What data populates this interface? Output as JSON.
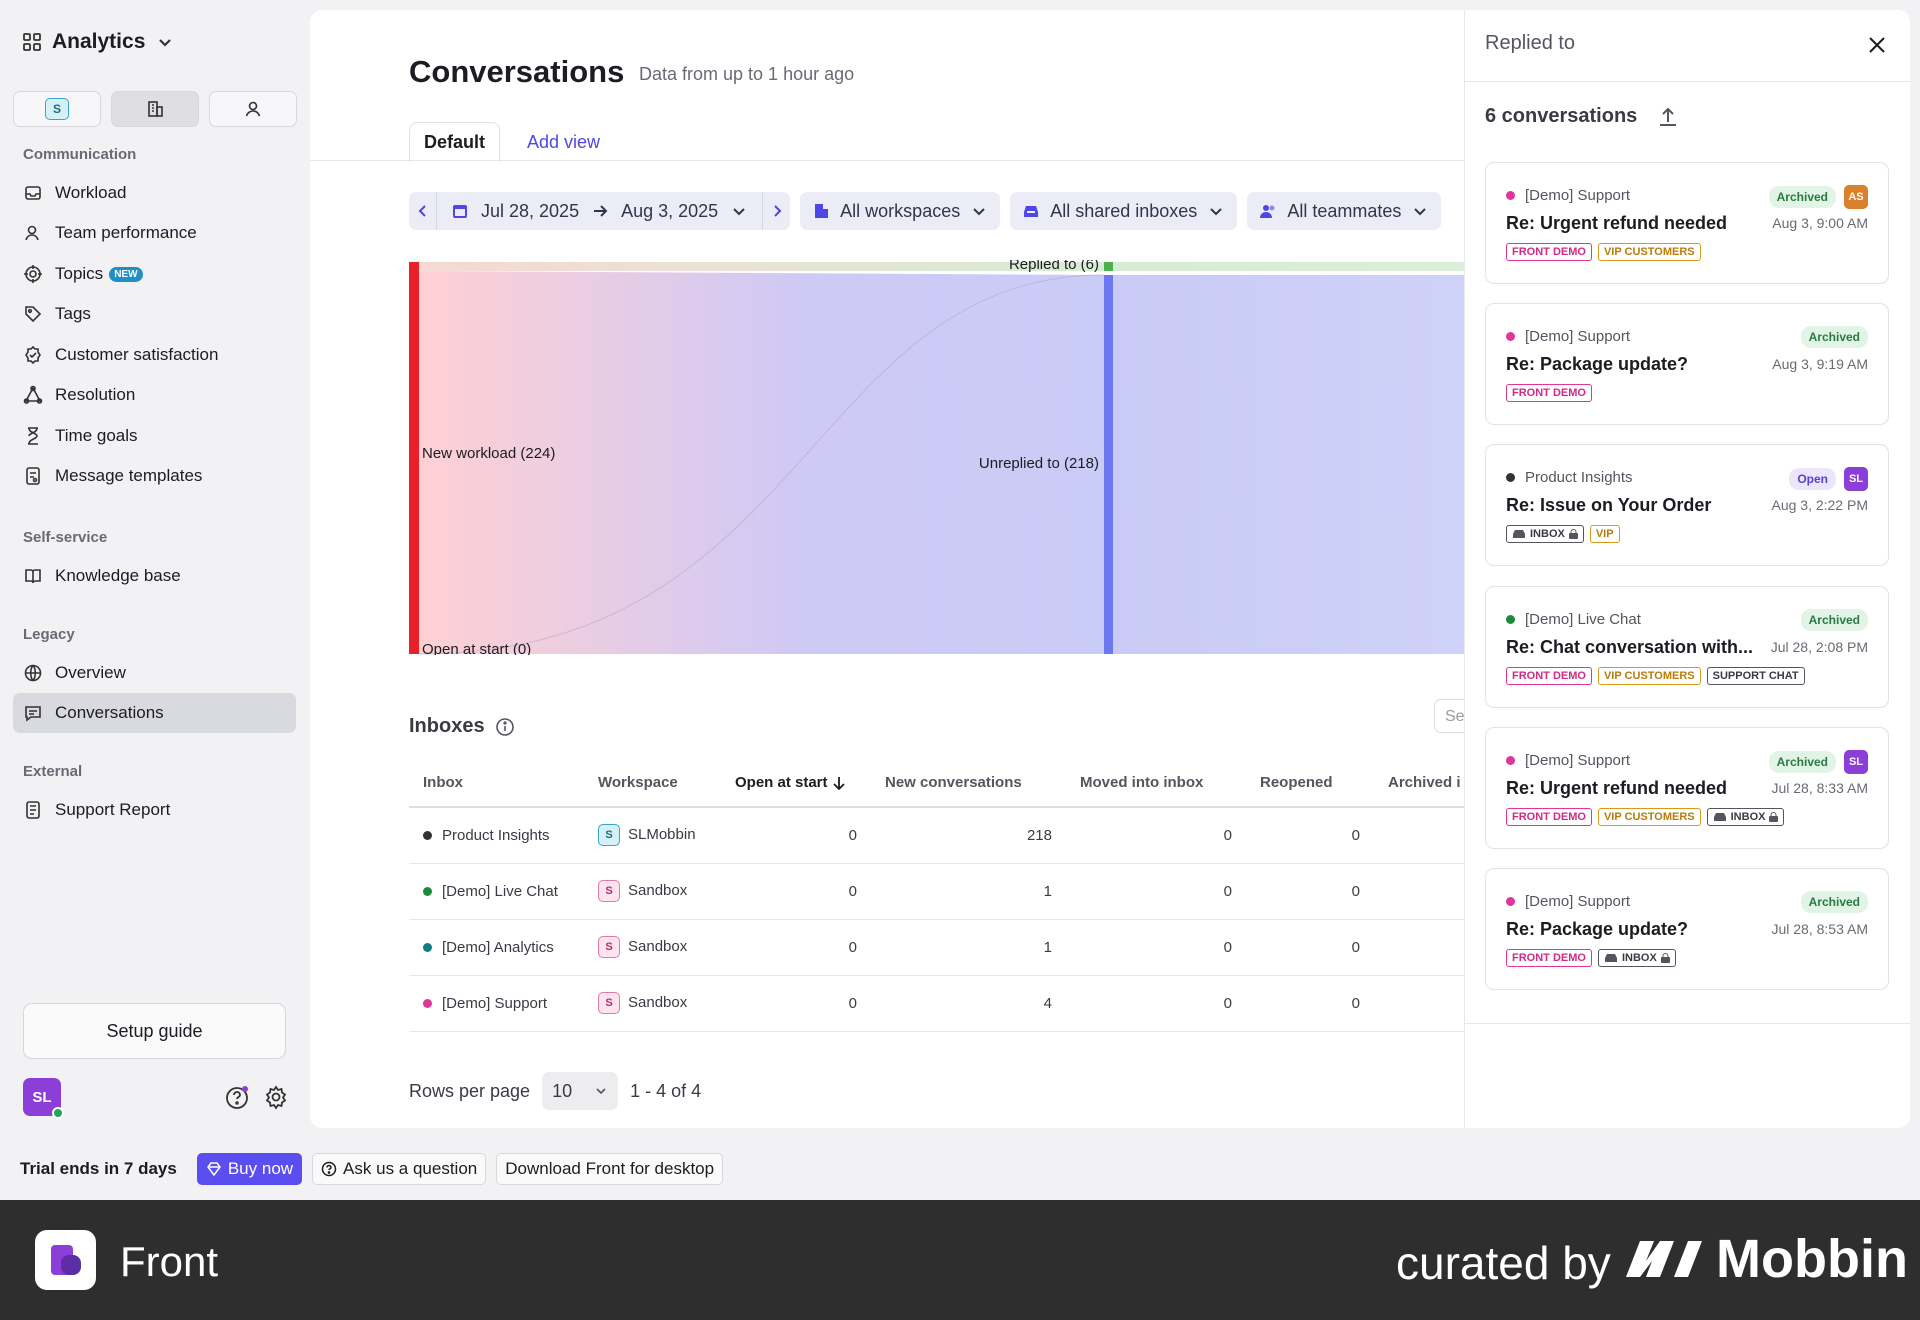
{
  "sidebar": {
    "app_title": "Analytics",
    "toggle_badge": "S",
    "sections": {
      "communication": "Communication",
      "self_service": "Self-service",
      "legacy": "Legacy",
      "external": "External"
    },
    "items": {
      "workload": "Workload",
      "team_performance": "Team performance",
      "topics": "Topics",
      "topics_badge": "NEW",
      "tags": "Tags",
      "customer_satisfaction": "Customer satisfaction",
      "resolution": "Resolution",
      "time_goals": "Time goals",
      "message_templates": "Message templates",
      "knowledge_base": "Knowledge base",
      "overview": "Overview",
      "conversations": "Conversations",
      "support_report": "Support Report"
    },
    "setup_guide": "Setup guide",
    "avatar_initials": "SL"
  },
  "header": {
    "title": "Conversations",
    "subtitle": "Data from up to 1 hour ago",
    "tabs": {
      "default": "Default",
      "add_view": "Add view"
    }
  },
  "filters": {
    "start_date": "Jul 28, 2025",
    "end_date": "Aug 3, 2025",
    "workspaces": "All workspaces",
    "inboxes": "All shared inboxes",
    "teammates": "All teammates"
  },
  "sankey": {
    "nodes": {
      "new_workload": "New workload (224)",
      "open_at_start": "Open at start (0)",
      "replied_to": "Replied to (6)",
      "unreplied_to": "Unreplied to (218)"
    },
    "colors": {
      "source": "#e8202a",
      "replied": "#4caf50",
      "unreplied": "#6c78f0"
    }
  },
  "inboxes": {
    "title": "Inboxes",
    "search_placeholder": "Se",
    "columns": [
      "Inbox",
      "Workspace",
      "Open at start",
      "New conversations",
      "Moved into inbox",
      "Reopened",
      "Archived i"
    ],
    "rows": [
      {
        "inbox": "Product Insights",
        "dot": "#333333",
        "ws_badge": "S",
        "ws_color": "cyan",
        "workspace": "SLMobbin",
        "open": "0",
        "new": "218",
        "moved": "0",
        "reopened": "0"
      },
      {
        "inbox": "[Demo] Live Chat",
        "dot": "#1e8a3c",
        "ws_badge": "S",
        "ws_color": "pink",
        "workspace": "Sandbox",
        "open": "0",
        "new": "1",
        "moved": "0",
        "reopened": "0"
      },
      {
        "inbox": "[Demo] Analytics",
        "dot": "#0e7c86",
        "ws_badge": "S",
        "ws_color": "pink",
        "workspace": "Sandbox",
        "open": "0",
        "new": "1",
        "moved": "0",
        "reopened": "0"
      },
      {
        "inbox": "[Demo] Support",
        "dot": "#e0359a",
        "ws_badge": "S",
        "ws_color": "pink",
        "workspace": "Sandbox",
        "open": "0",
        "new": "4",
        "moved": "0",
        "reopened": "0"
      }
    ]
  },
  "pagination": {
    "rows_per_page_label": "Rows per page",
    "rows_per_page": "10",
    "range": "1 - 4 of 4"
  },
  "panel": {
    "title": "Replied to",
    "count": "6 conversations",
    "cards": [
      {
        "inbox": "[Demo] Support",
        "dot": "#e0359a",
        "status": "Archived",
        "avatar": "AS",
        "avatar_color": "#d9822b",
        "subject": "Re: Urgent refund needed",
        "date": "Aug 3, 9:00 AM",
        "tags": [
          "FRONT DEMO",
          "VIP CUSTOMERS"
        ]
      },
      {
        "inbox": "[Demo] Support",
        "dot": "#e0359a",
        "status": "Archived",
        "avatar": "",
        "subject": "Re: Package update?",
        "date": "Aug 3, 9:19 AM",
        "tags": [
          "FRONT DEMO"
        ]
      },
      {
        "inbox": "Product Insights",
        "dot": "#333333",
        "status": "Open",
        "avatar": "SL",
        "avatar_color": "#8c3fd8",
        "subject": "Re: Issue on Your Order",
        "date": "Aug 3, 2:22 PM",
        "tags": [
          "INBOX",
          "VIP"
        ]
      },
      {
        "inbox": "[Demo] Live Chat",
        "dot": "#1e8a3c",
        "status": "Archived",
        "avatar": "",
        "subject": "Re: Chat conversation with...",
        "date": "Jul 28, 2:08 PM",
        "tags": [
          "FRONT DEMO",
          "VIP CUSTOMERS",
          "SUPPORT CHAT"
        ]
      },
      {
        "inbox": "[Demo] Support",
        "dot": "#e0359a",
        "status": "Archived",
        "avatar": "SL",
        "avatar_color": "#8c3fd8",
        "subject": "Re: Urgent refund needed",
        "date": "Jul 28, 8:33 AM",
        "tags": [
          "FRONT DEMO",
          "VIP CUSTOMERS",
          "INBOX"
        ]
      },
      {
        "inbox": "[Demo] Support",
        "dot": "#e0359a",
        "status": "Archived",
        "avatar": "",
        "subject": "Re: Package update?",
        "date": "Jul 28, 8:53 AM",
        "tags": [
          "FRONT DEMO",
          "INBOX"
        ]
      }
    ]
  },
  "trial": {
    "label": "Trial ends in 7 days",
    "buy": "Buy now",
    "ask": "Ask us a question",
    "download": "Download Front for desktop"
  },
  "footer": {
    "brand": "Front",
    "curated": "curated by",
    "mobbin": "Mobbin"
  }
}
